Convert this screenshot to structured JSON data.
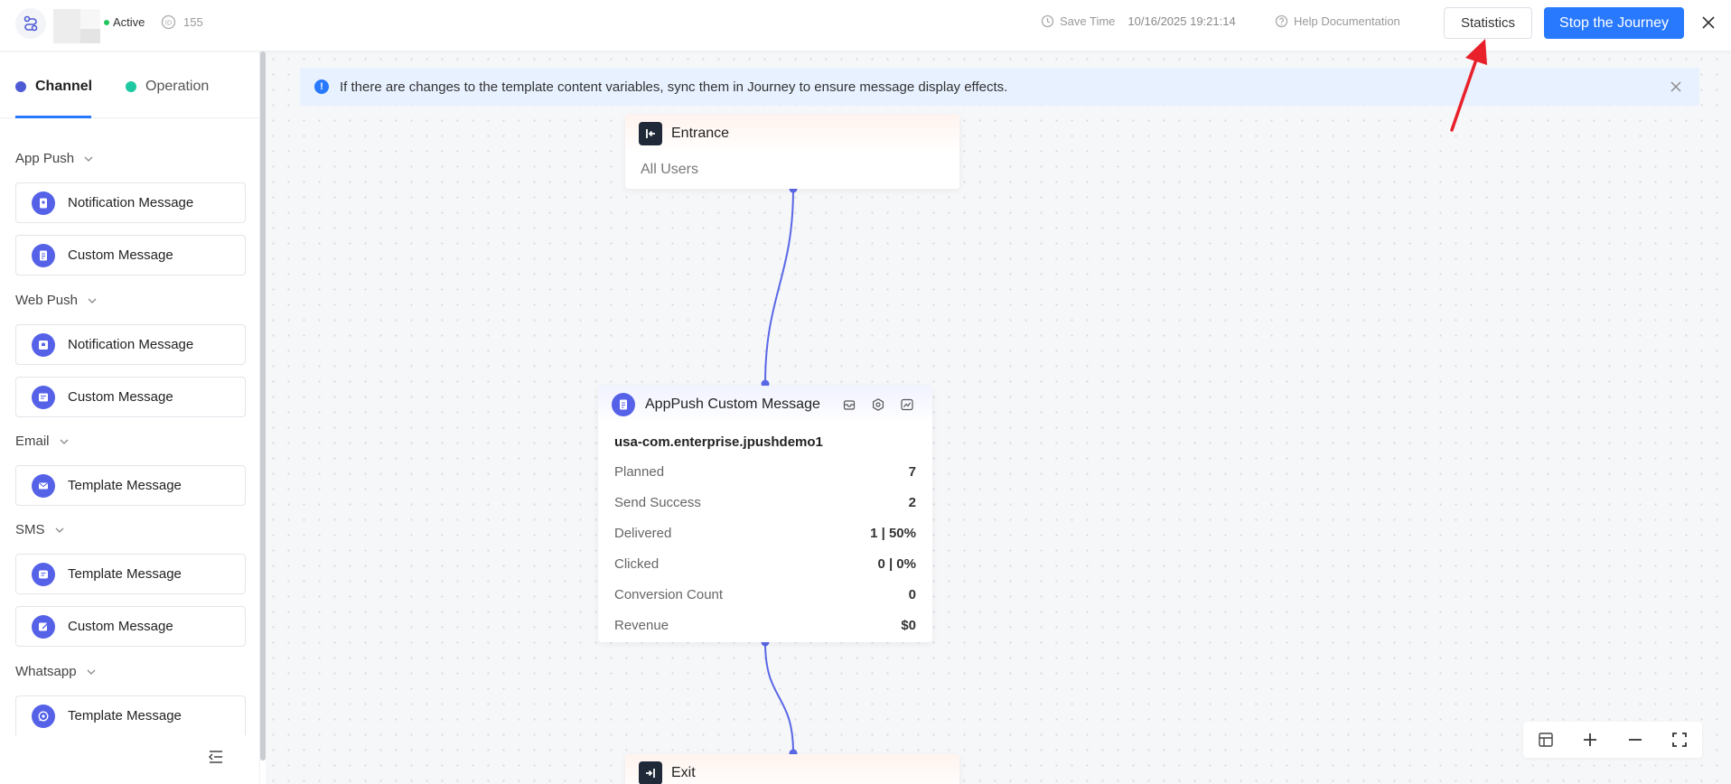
{
  "header": {
    "status": "Active",
    "id": "155",
    "save_time_label": "Save Time",
    "save_time_value": "10/16/2025 19:21:14",
    "help_label": "Help Documentation",
    "statistics_label": "Statistics",
    "stop_label": "Stop the Journey"
  },
  "sidebar": {
    "tabs": [
      {
        "label": "Channel",
        "active": true
      },
      {
        "label": "Operation",
        "active": false
      }
    ],
    "groups": [
      {
        "label": "App Push",
        "items": [
          "Notification Message",
          "Custom Message"
        ]
      },
      {
        "label": "Web Push",
        "items": [
          "Notification Message",
          "Custom Message"
        ]
      },
      {
        "label": "Email",
        "items": [
          "Template Message"
        ]
      },
      {
        "label": "SMS",
        "items": [
          "Template Message",
          "Custom Message"
        ]
      },
      {
        "label": "Whatsapp",
        "items": [
          "Template Message"
        ]
      }
    ]
  },
  "notice": {
    "text": "If there are changes to the template content variables, sync them in Journey to ensure message display effects."
  },
  "nodes": {
    "entrance": {
      "title": "Entrance",
      "subtitle": "All Users"
    },
    "message": {
      "title": "AppPush Custom Message",
      "app": "usa-com.enterprise.jpushdemo1",
      "metrics": [
        {
          "label": "Planned",
          "value": "7"
        },
        {
          "label": "Send Success",
          "value": "2"
        },
        {
          "label": "Delivered",
          "value": "1 | 50%"
        },
        {
          "label": "Clicked",
          "value": "0 | 0%"
        },
        {
          "label": "Conversion Count",
          "value": "0"
        },
        {
          "label": "Revenue",
          "value": "$0"
        }
      ]
    },
    "exit": {
      "title": "Exit"
    }
  },
  "colors": {
    "primary": "#2979ff",
    "channel": "#4f5bd5",
    "operation": "#1ec8a0",
    "edge": "#5a67e6",
    "active": "#22c55e",
    "annotation_arrow": "#e8202a"
  }
}
